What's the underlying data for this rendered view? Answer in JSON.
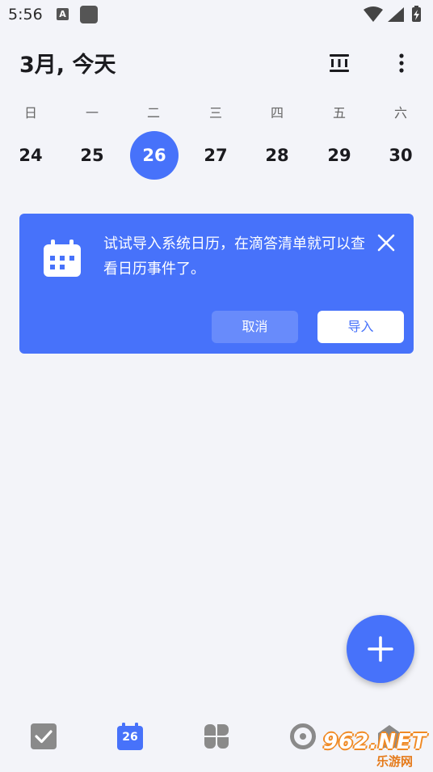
{
  "status_bar": {
    "time": "5:56",
    "a_badge": "A"
  },
  "header": {
    "title": "3月, 今天"
  },
  "week": {
    "weekdays": [
      "日",
      "一",
      "二",
      "三",
      "四",
      "五",
      "六"
    ],
    "dates": [
      "24",
      "25",
      "26",
      "27",
      "28",
      "29",
      "30"
    ],
    "selected_index": 2
  },
  "banner": {
    "message": "试试导入系统日历，在滴答清单就可以查看日历事件了。",
    "cancel_label": "取消",
    "import_label": "导入"
  },
  "bottom_nav": {
    "calendar_day": "26"
  },
  "watermark": {
    "big": "962.NET",
    "small": "乐游网"
  },
  "colors": {
    "accent": "#4772fa",
    "background": "#f3f4f9",
    "icon_gray": "#8a8a8a"
  }
}
